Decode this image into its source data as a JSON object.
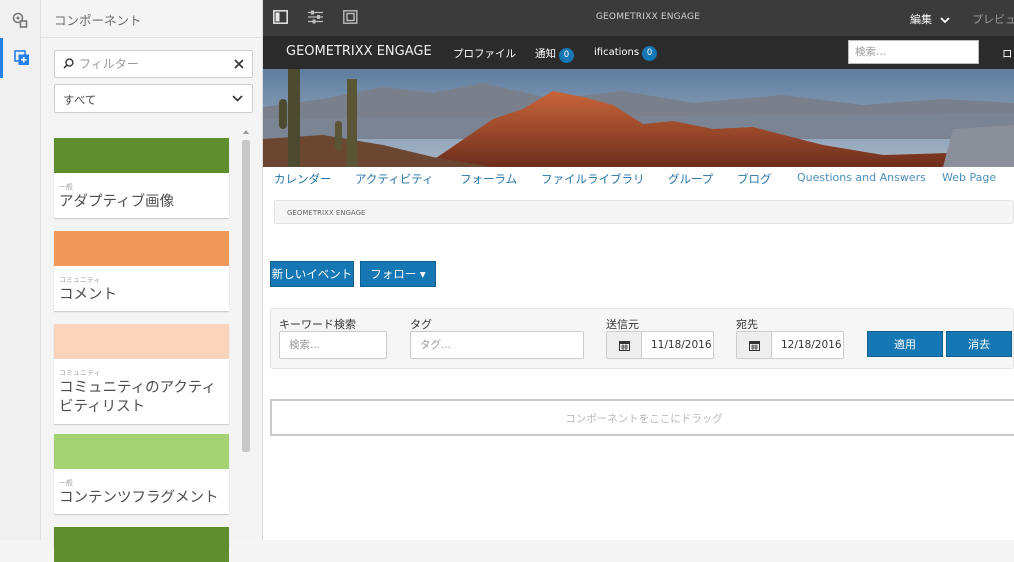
{
  "panel": {
    "title": "コンポーネント",
    "filter_placeholder": "フィルター",
    "group_select": "すべて",
    "components": [
      {
        "group": "一般",
        "name": "アダプティブ画像",
        "color": "#5f8e2e"
      },
      {
        "group": "コミュニティ",
        "name": "コメント",
        "color": "#f0975a"
      },
      {
        "group": "コミュニティ",
        "name": "コミュニティのアクティビティリスト",
        "color": "#fad5bc"
      },
      {
        "group": "一般",
        "name": "コンテンツフラグメント",
        "color": "#a5d274"
      },
      {
        "group": "",
        "name": "",
        "color": "#5f8e2e"
      }
    ]
  },
  "topbar": {
    "page_title": "GEOMETRIXX ENGAGE",
    "mode_label": "編集",
    "preview_label": "プレビュー"
  },
  "site": {
    "logo": "GEOMETRIXX ENGAGE",
    "profile_link": "プロファイル",
    "notifications_label": "通知",
    "notifications_count": "0",
    "notifications_partial_label": "ifications",
    "notifications_partial_count": "0",
    "search_placeholder": "検索...",
    "login_partial": "ロ"
  },
  "tabs": [
    "カレンダー",
    "アクティビティ",
    "フォーラム",
    "ファイルライブラリ",
    "グループ",
    "ブログ",
    "Questions and Answers",
    "Web Page"
  ],
  "breadcrumb": "GEOMETRIXX ENGAGE",
  "actions": {
    "new_event": "新しいイベント",
    "follow": "フォロー ▾"
  },
  "filters": {
    "keyword_label": "キーワード検索",
    "keyword_placeholder": "検索...",
    "tag_label": "タグ",
    "tag_placeholder": "タグ...",
    "from_label": "送信元",
    "from_value": "11/18/2016",
    "to_label": "宛先",
    "to_value": "12/18/2016",
    "apply": "適用",
    "clear": "消去"
  },
  "dropzone": "コンポーネントをここにドラッグ",
  "colors": {
    "accent_blue": "#1577b3",
    "topbar": "#3b3b3b",
    "sitenav": "#2b2b2b",
    "tab_link": "#2474a8"
  }
}
